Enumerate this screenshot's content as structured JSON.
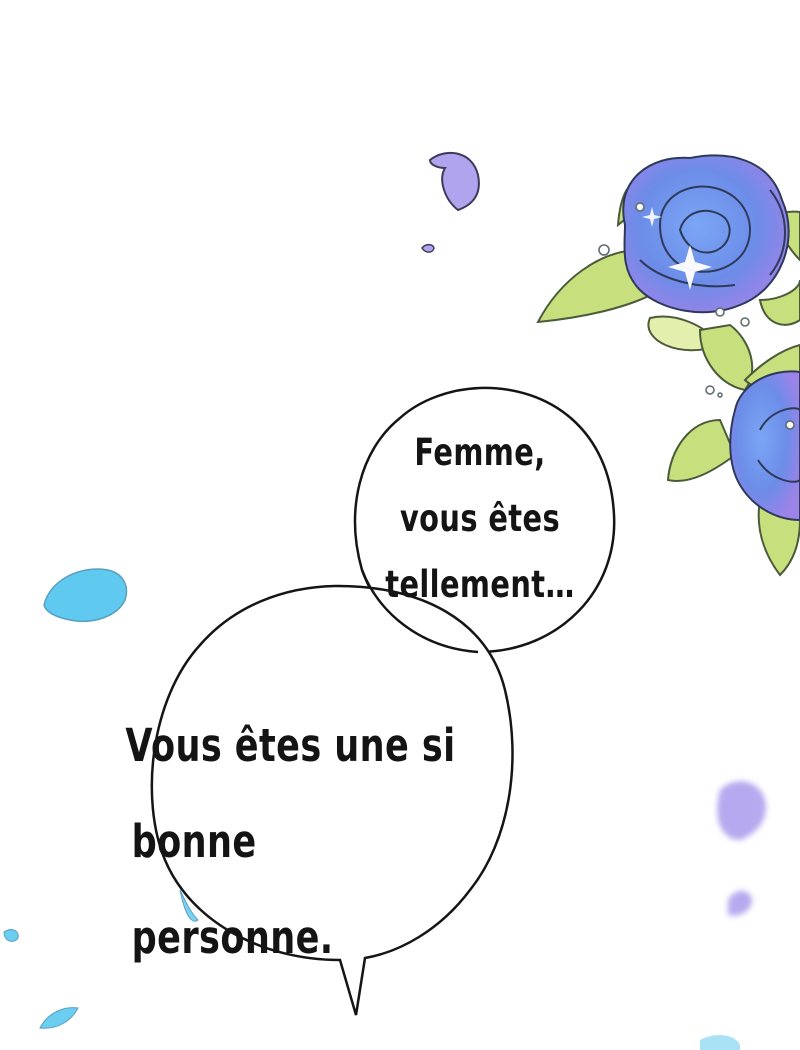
{
  "small_bubble": {
    "lines": [
      "Femme,",
      "vous êtes",
      "tellement…"
    ]
  },
  "big_bubble": {
    "lines": [
      "Vous êtes une si",
      "bonne personne."
    ]
  },
  "decorations": {
    "flowers": [
      "blue-rose-icon",
      "blue-rose-icon"
    ],
    "petals": [
      "purple-petal-icon",
      "cyan-petal-icon"
    ],
    "colors": {
      "rose_blue": "#6f8ff0",
      "rose_purple": "#9a86ec",
      "leaf_green": "#c5de7a",
      "petal_cyan": "#5cc7ee",
      "petal_lilac": "#b3a6ee"
    }
  }
}
